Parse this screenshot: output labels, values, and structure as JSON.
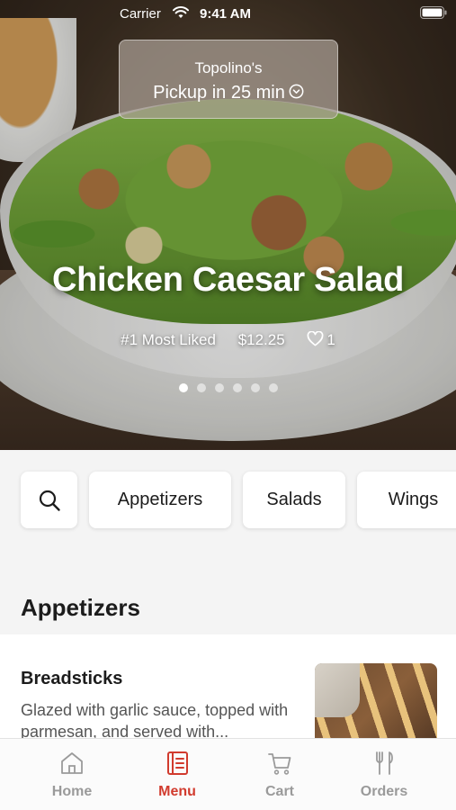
{
  "status_bar": {
    "carrier": "Carrier",
    "time": "9:41 AM"
  },
  "pickup": {
    "store": "Topolino's",
    "pickup_text": "Pickup in 25 min"
  },
  "hero": {
    "dish_name": "Chicken Caesar Salad",
    "rank": "#1 Most Liked",
    "price": "$12.25",
    "likes": "1",
    "carousel_total": 6,
    "carousel_active": 1
  },
  "categories": {
    "search_icon": "search-icon",
    "items": [
      "Appetizers",
      "Salads",
      "Wings"
    ]
  },
  "section": {
    "title": "Appetizers"
  },
  "menu_item": {
    "name": "Breadsticks",
    "description": "Glazed with garlic sauce, topped with parmesan, and served with..."
  },
  "tabbar": {
    "active_color": "#d13b2e",
    "inactive_color": "#9a9a9a",
    "tabs": [
      {
        "label": "Home",
        "icon": "home-icon"
      },
      {
        "label": "Menu",
        "icon": "menu-icon"
      },
      {
        "label": "Cart",
        "icon": "cart-icon"
      },
      {
        "label": "Orders",
        "icon": "orders-icon"
      }
    ]
  }
}
